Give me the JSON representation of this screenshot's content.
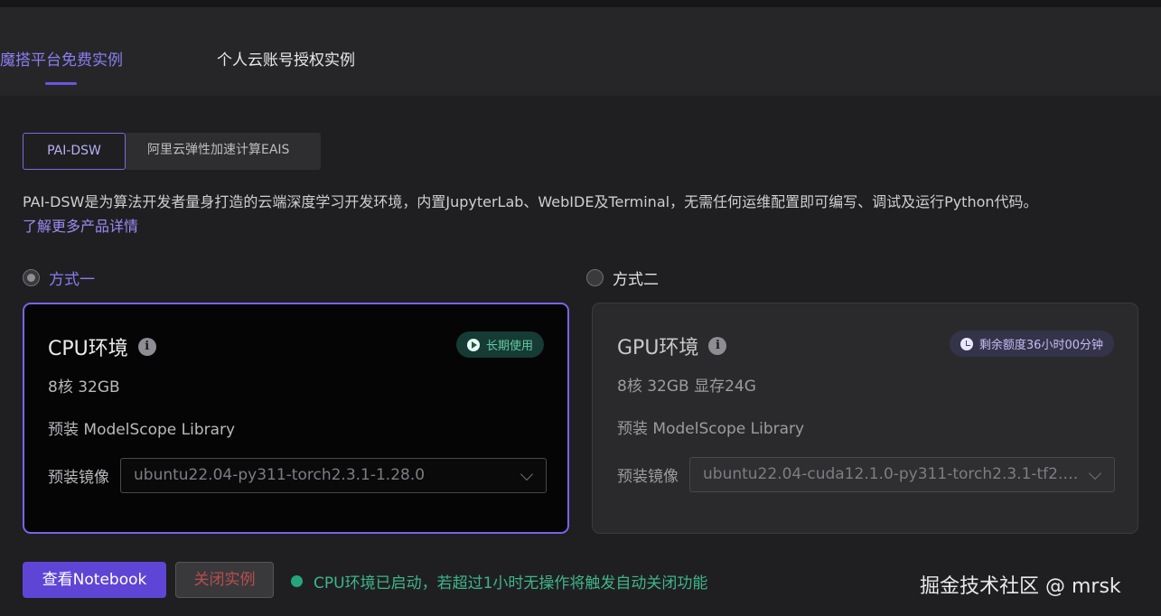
{
  "tabs": [
    {
      "label": "魔搭平台免费实例",
      "active": true
    },
    {
      "label": "个人云账号授权实例",
      "active": false
    }
  ],
  "segmented": [
    {
      "label": "PAI-DSW",
      "active": true
    },
    {
      "label": "阿里云弹性加速计算EAIS",
      "active": false
    }
  ],
  "description": "PAI-DSW是为算法开发者量身打造的云端深度学习开发环境，内置JupyterLab、WebIDE及Terminal，无需任何运维配置即可编写、调试及运行Python代码。",
  "more_link": "了解更多产品详情",
  "options": [
    {
      "label": "方式一",
      "checked": true
    },
    {
      "label": "方式二",
      "checked": false
    }
  ],
  "cards": {
    "cpu": {
      "title": "CPU环境",
      "badge": "长期使用",
      "spec": "8核 32GB",
      "library": "预装 ModelScope Library",
      "image_label": "预装镜像",
      "image_value": "ubuntu22.04-py311-torch2.3.1-1.28.0"
    },
    "gpu": {
      "title": "GPU环境",
      "badge": "剩余额度36小时00分钟",
      "spec": "8核 32GB 显存24G",
      "library": "预装 ModelScope Library",
      "image_label": "预装镜像",
      "image_value": "ubuntu22.04-cuda12.1.0-py311-torch2.3.1-tf2.1..."
    }
  },
  "actions": {
    "view_label": "查看Notebook",
    "close_label": "关闭实例"
  },
  "status_text": "CPU环境已启动，若超过1小时无操作将触发自动关闭功能",
  "watermark": "掘金技术社区 @ mrsk",
  "colors": {
    "accent": "#6b55e3",
    "success": "#24a67a",
    "danger": "#b94d4d"
  }
}
